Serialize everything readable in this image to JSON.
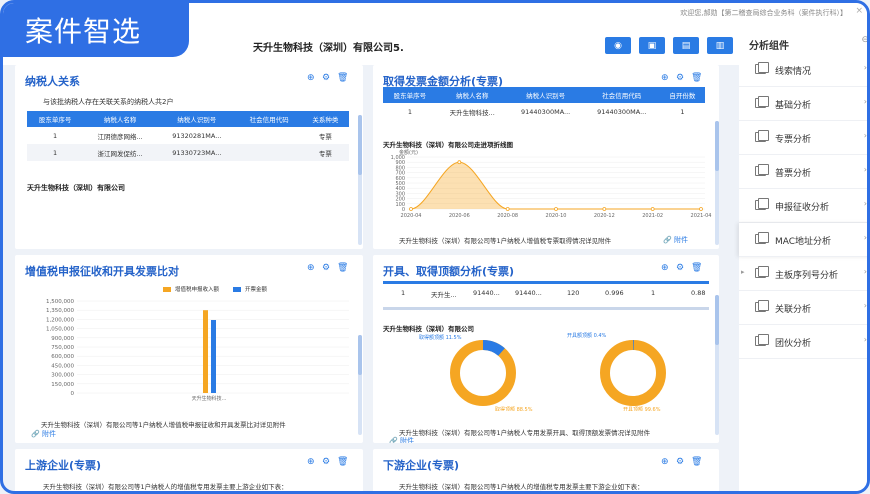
{
  "badge": "案件智选",
  "topbar": {
    "user_text": "欢迎您,郝勋【第二稽查局综合业务科（案件执行科）】",
    "close": "×"
  },
  "title": "天升生物科技（深圳）有限公司5.",
  "toolbar": {
    "view": "◉",
    "b2": "▣",
    "b3": "▤",
    "b4": "▥"
  },
  "panel1": {
    "title": "纳税人关系",
    "desc": "与该批纳税人存在关联关系的纳税人共2户",
    "headers": [
      "股东单序号",
      "纳税人名称",
      "纳税人识别号",
      "社会信用代码",
      "关系种类"
    ],
    "rows": [
      [
        "1",
        "江阴德彦网络...",
        "91320281MA...",
        "",
        "专票"
      ],
      [
        "1",
        "浙江网发促纺...",
        "91330723MA...",
        "",
        "专票"
      ]
    ],
    "footer": "天升生物科技（深圳）有限公司"
  },
  "panel2": {
    "title": "取得发票金额分析(专票)",
    "headers": [
      "股东单序号",
      "纳税人名称",
      "纳税人识别号",
      "社会信用代码",
      "自开份数"
    ],
    "rows": [
      [
        "1",
        "天升生物科技...",
        "91440300MA...",
        "91440300MA...",
        "1"
      ]
    ],
    "chart_title": "天升生物科技（深圳）有限公司走进项折线图",
    "caption": "天升生物科技（深圳）有限公司等1户纳税人增值税专票取得情况详见附件",
    "attach": "附件"
  },
  "panel3": {
    "title": "增值税申报征收和开具发票比对",
    "legend": [
      "增值税申报收入额",
      "开票金额"
    ],
    "caption": "天升生物科技（深圳）有限公司等1户纳税人增值税申报征收和开具发票比对详见附件",
    "attach": "附件"
  },
  "panel4": {
    "title": "开具、取得顶额分析(专票)",
    "row": [
      "1",
      "天升生...",
      "91440...",
      "91440...",
      "120",
      "0.996",
      "1",
      "0.88"
    ],
    "company": "天升生物科技（深圳）有限公司",
    "caption": "天升生物科技（深圳）有限公司等1户纳税人专用发票开具、取得顶额发票情况详见附件",
    "attach": "附件"
  },
  "panel5": {
    "title": "上游企业(专票)",
    "text": "天升生物科技（深圳）有限公司等1户纳税人的增值税专用发票主要上游企业如下表："
  },
  "panel6": {
    "title": "下游企业(专票)",
    "text": "天升生物科技（深圳）有限公司等1户纳税人的增值税专用发票主要下游企业如下表："
  },
  "sidebar": {
    "title": "分析组件",
    "items": [
      "线索情况",
      "基础分析",
      "专票分析",
      "普票分析",
      "申报征收分析",
      "MAC地址分析",
      "主板序列号分析",
      "关联分析",
      "团伙分析"
    ]
  },
  "chart_data": [
    {
      "type": "area",
      "ylabel": "金额(元)",
      "x": [
        "2020-04",
        "2020-06",
        "2020-08",
        "2020-10",
        "2020-12",
        "2021-02",
        "2021-04"
      ],
      "y": [
        0,
        900,
        0,
        0,
        0,
        0,
        0
      ],
      "ylim": [
        0,
        1000
      ],
      "yticks": [
        "0",
        "100",
        "200",
        "300",
        "400",
        "500",
        "600",
        "700",
        "800",
        "900",
        "1,000"
      ],
      "color": "#f5a623"
    },
    {
      "type": "bar",
      "categories": [
        "天升生物科技..."
      ],
      "series": [
        {
          "name": "增值税申报收入额",
          "values": [
            1350000
          ],
          "color": "#f5a623"
        },
        {
          "name": "开票金额",
          "values": [
            1190000
          ],
          "color": "#2a7be4"
        }
      ],
      "ylim": [
        0,
        1500000
      ],
      "yticks": [
        "0",
        "150,000",
        "300,000",
        "450,000",
        "600,000",
        "750,000",
        "900,000",
        "1,050,000",
        "1,200,000",
        "1,350,000",
        "1,500,000"
      ]
    },
    {
      "type": "pie",
      "labels": [
        "取得额顶额 11.5%",
        "取得顶额 88.5%"
      ],
      "values": [
        11.5,
        88.5
      ],
      "colors": [
        "#2a7be4",
        "#f5a623"
      ]
    },
    {
      "type": "pie",
      "labels": [
        "开具额顶额 0.4%",
        "开具顶额 99.6%"
      ],
      "values": [
        0.4,
        99.6
      ],
      "colors": [
        "#2a7be4",
        "#f5a623"
      ]
    }
  ]
}
